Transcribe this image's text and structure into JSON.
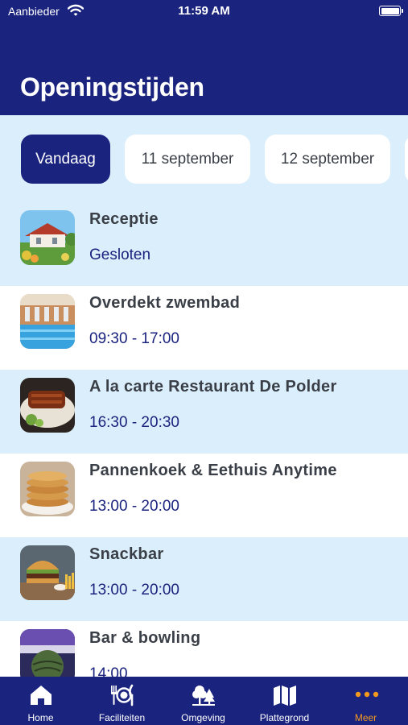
{
  "status_bar": {
    "carrier": "Aanbieder",
    "time": "11:59 AM"
  },
  "header": {
    "title": "Openingstijden"
  },
  "dates": [
    {
      "label": "Vandaag",
      "active": true
    },
    {
      "label": "11 september",
      "active": false
    },
    {
      "label": "12 september",
      "active": false
    }
  ],
  "facilities": [
    {
      "name": "Receptie",
      "hours": "Gesloten",
      "icon": "reception-photo"
    },
    {
      "name": "Overdekt zwembad",
      "hours": "09:30 - 17:00",
      "icon": "pool-photo"
    },
    {
      "name": "A la carte Restaurant De Polder",
      "hours": "16:30 - 20:30",
      "icon": "ribs-photo"
    },
    {
      "name": "Pannenkoek & Eethuis Anytime",
      "hours": "13:00 - 20:00",
      "icon": "pancakes-photo"
    },
    {
      "name": "Snackbar",
      "hours": "13:00 - 20:00",
      "icon": "burger-photo"
    },
    {
      "name": "Bar & bowling",
      "hours": "14:00",
      "icon": "bowling-photo"
    }
  ],
  "tabs": [
    {
      "label": "Home",
      "icon": "home-icon",
      "active": false
    },
    {
      "label": "Faciliteiten",
      "icon": "cutlery-icon",
      "active": false
    },
    {
      "label": "Omgeving",
      "icon": "trees-icon",
      "active": false
    },
    {
      "label": "Plattegrond",
      "icon": "map-icon",
      "active": false
    },
    {
      "label": "Meer",
      "icon": "more-icon",
      "active": true
    }
  ],
  "colors": {
    "primary": "#1a237e",
    "light_row": "#dbeefb",
    "accent": "#f39a1e",
    "text": "#3a3f47"
  }
}
